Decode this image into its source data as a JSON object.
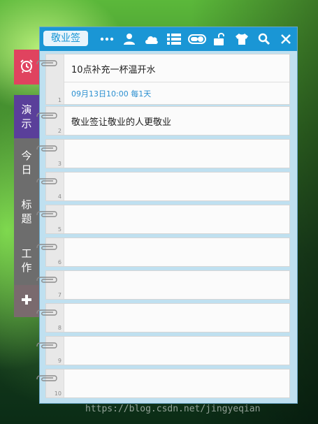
{
  "app": {
    "brand_label": "敬业签"
  },
  "toolbar": {
    "icons": [
      "more-icon",
      "user-icon",
      "cloud-icon",
      "list-icon",
      "toggle-icon",
      "unlock-icon",
      "shirt-icon",
      "search-icon",
      "close-icon"
    ]
  },
  "sidebar": {
    "tabs": [
      {
        "label": "",
        "icon": "alarm-clock-icon",
        "color": "#e0435f"
      },
      {
        "label": "演示",
        "color": "#5a3f9a"
      },
      {
        "label": "今日",
        "color": "#6d6d6d"
      },
      {
        "label": "标题",
        "color": "#6d6d6d"
      },
      {
        "label": "工作",
        "color": "#6d6d6d"
      },
      {
        "label": "",
        "icon": "plus-icon",
        "color": "#7a6a6e"
      }
    ]
  },
  "notes": [
    {
      "number": "1",
      "text": "10点补充一杯温开水",
      "reminder": "09月13日10:00 每1天"
    },
    {
      "number": "2",
      "text": "敬业签让敬业的人更敬业",
      "reminder": ""
    },
    {
      "number": "3",
      "text": "",
      "reminder": ""
    },
    {
      "number": "4",
      "text": "",
      "reminder": ""
    },
    {
      "number": "5",
      "text": "",
      "reminder": ""
    },
    {
      "number": "6",
      "text": "",
      "reminder": ""
    },
    {
      "number": "7",
      "text": "",
      "reminder": ""
    },
    {
      "number": "8",
      "text": "",
      "reminder": ""
    },
    {
      "number": "9",
      "text": "",
      "reminder": ""
    },
    {
      "number": "10",
      "text": "",
      "reminder": ""
    }
  ],
  "watermark": "https://blog.csdn.net/jingyeqian",
  "colors": {
    "toolbar": "#1a96d5",
    "accent_text": "#2a8fd0"
  }
}
